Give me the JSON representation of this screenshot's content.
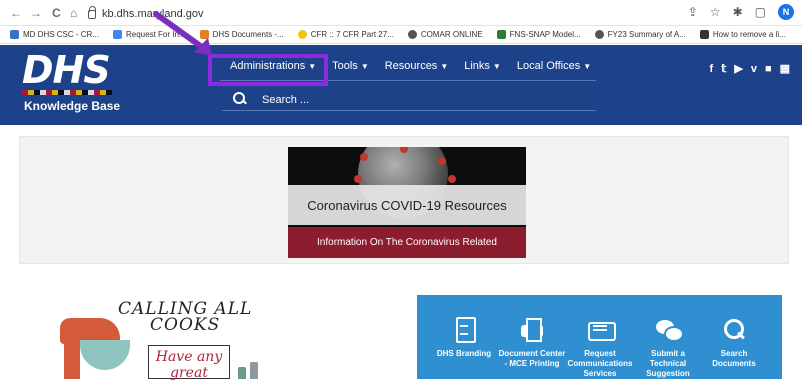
{
  "browser": {
    "back": "←",
    "forward": "→",
    "reload": "C",
    "home": "⌂",
    "url": "kb.dhs.maryland.gov",
    "share": "⇪",
    "star": "☆",
    "extensions": "✱",
    "sidepanel": "▢",
    "profile_initial": "N"
  },
  "bookmarks": [
    {
      "label": "MD DHS CSC - CR...",
      "color": "#3b6fc8"
    },
    {
      "label": "Request For In...",
      "color": "#4285f4"
    },
    {
      "label": "DHS Documents -...",
      "color": "#e67e22"
    },
    {
      "label": "CFR :: 7 CFR Part 27...",
      "color": "#f1c40f"
    },
    {
      "label": "COMAR ONLINE",
      "color": "#555555"
    },
    {
      "label": "FNS-SNAP Model...",
      "color": "#2e7d32"
    },
    {
      "label": "FY23 Summary of A...",
      "color": "#555555"
    },
    {
      "label": "How to remove a li...",
      "color": "#333333"
    }
  ],
  "header": {
    "logo": "DHS",
    "subtitle": "Knowledge Base",
    "nav": [
      {
        "label": "Administrations"
      },
      {
        "label": "Tools"
      },
      {
        "label": "Resources"
      },
      {
        "label": "Links"
      },
      {
        "label": "Local Offices"
      }
    ],
    "search_placeholder": "Search ...",
    "social": [
      "f",
      "𝕥",
      "▶",
      "v",
      "■",
      "▦"
    ]
  },
  "banner": {
    "title": "Coronavirus COVID-19 Resources",
    "subtitle": "Information On The Coronavirus Related"
  },
  "promo": {
    "line1": "CALLING ALL",
    "line2": "COOKS",
    "line3": "Have any",
    "line4": "great"
  },
  "resources": [
    {
      "label": "DHS Branding",
      "icon": "document-icon"
    },
    {
      "label": "Document Center - MCE Printing",
      "icon": "printer-icon"
    },
    {
      "label": "Request Communications Services",
      "icon": "keyboard-icon"
    },
    {
      "label": "Submit a Technical Suggestion",
      "icon": "chat-icon"
    },
    {
      "label": "Search Documents",
      "icon": "search-icon"
    }
  ],
  "colors": {
    "header_bg": "#1e4289",
    "highlight": "#8a2be2",
    "resources_bg": "#2f8fd0",
    "covid_footer": "#8c1d2e"
  }
}
